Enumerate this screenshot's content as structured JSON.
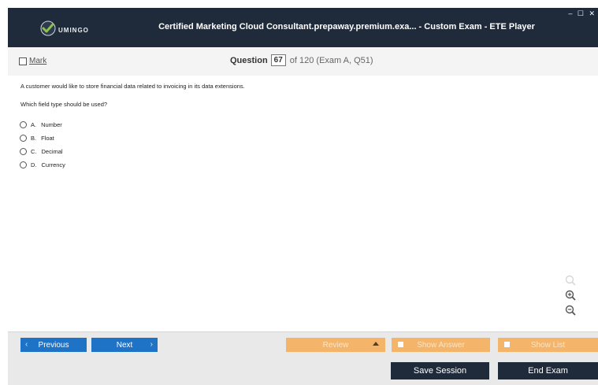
{
  "app": {
    "logo_text": "UMINGO",
    "title": "Certified Marketing Cloud Consultant.prepaway.premium.exa... - Custom Exam - ETE Player",
    "window_controls": "– ☐ ✕"
  },
  "header": {
    "mark_label": "Mark",
    "question_label": "Question",
    "question_number": "67",
    "question_rest": "of 120 (Exam A, Q51)"
  },
  "question": {
    "stem": "A customer would like to store financial data related to invoicing in its data extensions.",
    "prompt": "Which field type should be used?",
    "options": [
      {
        "letter": "A.",
        "text": "Number"
      },
      {
        "letter": "B.",
        "text": "Float"
      },
      {
        "letter": "C.",
        "text": "Decimal"
      },
      {
        "letter": "D.",
        "text": "Currency"
      }
    ]
  },
  "nav": {
    "previous_label": "Previous",
    "next_label": "Next",
    "review_label": "Review",
    "show_answer_label": "Show Answer",
    "show_list_label": "Show List"
  },
  "footer": {
    "save_session_label": "Save Session",
    "end_exam_label": "End Exam"
  },
  "icons": {
    "logo": "umingo-logo-icon",
    "search": "search-icon",
    "zoom_in": "zoom-in-icon",
    "zoom_out": "zoom-out-icon"
  },
  "colors": {
    "titlebar": "#1f2a3b",
    "nav_blue": "#1f73c7",
    "review_orange": "#f4b56a",
    "footer_dark": "#1f2a3b"
  }
}
